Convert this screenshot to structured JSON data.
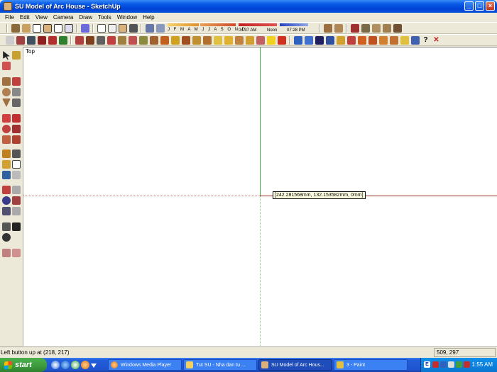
{
  "window": {
    "title": "SU Model of Arc House - SketchUp",
    "buttons": [
      "_",
      "□",
      "×"
    ]
  },
  "menu": [
    "File",
    "Edit",
    "View",
    "Camera",
    "Draw",
    "Tools",
    "Window",
    "Help"
  ],
  "toolbar1": {
    "icons_left": [
      "display-settings-icon",
      "page-icon",
      "home-icon",
      "house-icon",
      "house-outline-icon",
      "window-icon",
      "cube-icon",
      "wireframe-icon",
      "hidden-line-icon",
      "shaded-icon",
      "shaded-textured-icon",
      "monochrome-icon",
      "shadow-toggle-icon",
      "fog-icon"
    ],
    "shadow_months": "J F M A M J J A S O N D",
    "shadow_time_start": "04:37 AM",
    "shadow_time_mid": "Noon",
    "shadow_time_end": "07:28 PM",
    "icons_right": [
      "layers-icon",
      "scenes-icon",
      "paint-palette-icon",
      "components-icon",
      "materials-icon",
      "styles-icon",
      "entity-info-icon"
    ]
  },
  "toolbar2": {
    "icons": [
      "tape-icon",
      "sandbox-icon",
      "terrain-icon",
      "color-box-icon",
      "pencil-icon",
      "brush-icon",
      "settings-icon",
      "move-icon",
      "rotate-icon",
      "walk-icon",
      "scale-icon",
      "flip-icon",
      "select-icon",
      "follow-me-icon",
      "push-pull-icon",
      "offset-icon",
      "measure-icon",
      "protractor-icon",
      "axes-icon",
      "dimension-icon",
      "text-icon",
      "3d-text-icon",
      "section-icon",
      "paint-icon",
      "star-icon",
      "delete-icon",
      "camera-icon",
      "refresh-icon",
      "stack-icon",
      "layer-icon",
      "cylinder-icon",
      "hand-icon",
      "house-a-icon",
      "house-b-icon",
      "house-c-icon",
      "house-d-icon",
      "help-arrow-icon",
      "help-icon",
      "question-icon",
      "close-red-icon"
    ]
  },
  "viewport": {
    "scene_label": "Top",
    "tooltip": "[242.281568mm, 132.153582mm, 0mm]"
  },
  "status": {
    "message": "Left button up at (218, 217)",
    "coords": "509, 297"
  },
  "taskbar": {
    "start": "start",
    "tasks": [
      "Windows Media Player",
      "Tut SU - Nha dan tu ...",
      "SU Model of Arc Hous...",
      "3 - Paint"
    ],
    "tray_lang": "E",
    "clock": "1:55 AM"
  },
  "colors": {
    "axis_green": "#3cb13c",
    "axis_red": "#9a2a2a",
    "titlebar_blue": "#0042d6",
    "taskbar_blue": "#245edb",
    "start_green": "#3c9a3c"
  }
}
